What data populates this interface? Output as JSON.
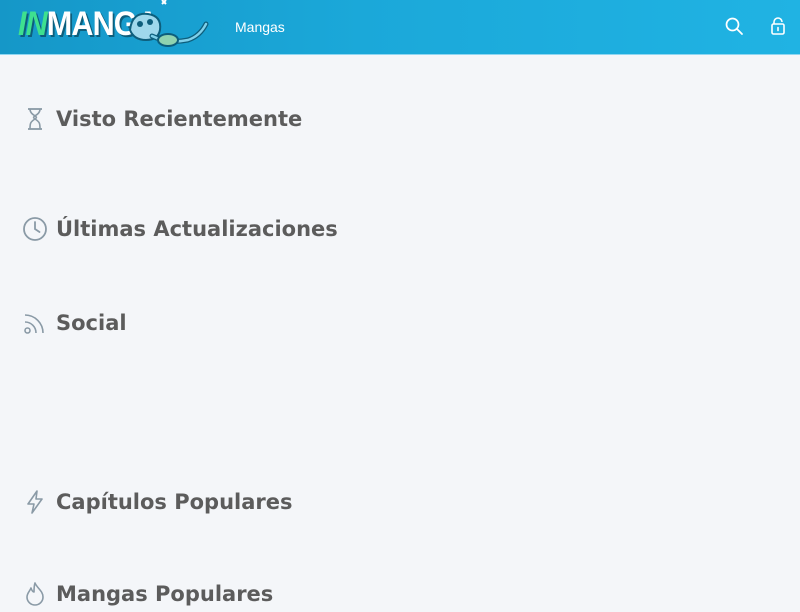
{
  "header": {
    "logo": {
      "part1": "IN",
      "part2": "MANGA"
    },
    "nav": {
      "mangas_label": "Mangas"
    },
    "icons": {
      "search": "search-icon",
      "login": "lock-icon"
    }
  },
  "sections": [
    {
      "icon": "hourglass-icon",
      "title": "Visto Recientemente"
    },
    {
      "icon": "clock-icon",
      "title": "Últimas Actualizaciones"
    },
    {
      "icon": "rss-icon",
      "title": "Social"
    },
    {
      "icon": "lightning-icon",
      "title": "Capítulos Populares"
    },
    {
      "icon": "fire-icon",
      "title": "Mangas Populares"
    }
  ],
  "colors": {
    "header_start": "#1597c8",
    "header_end": "#20b3e3",
    "logo_green": "#3ee08f",
    "page_background": "#f4f6f9",
    "section_text": "#5c5c5c",
    "section_icon": "#8a9aa6"
  }
}
